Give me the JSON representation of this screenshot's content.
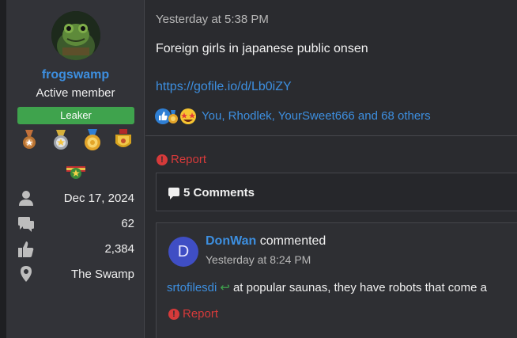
{
  "sidebar": {
    "username": "frogswamp",
    "user_title": "Active member",
    "rank_badge": "Leaker",
    "medals": [
      "bronze-medal-icon",
      "silver-medal-icon",
      "gold-medal-icon",
      "gold-shield-medal-icon",
      "red-ribbon-medal-icon"
    ],
    "stats": {
      "joined": "Dec 17, 2024",
      "messages": "62",
      "reactions": "2,384",
      "location": "The Swamp"
    }
  },
  "post": {
    "timestamp": "Yesterday at 5:38 PM",
    "text": "Foreign girls in japanese public onsen",
    "link": "https://gofile.io/d/Lb0iZY",
    "reaction_icons": [
      "like-icon",
      "award-icon",
      "star-eyes-emoji-icon"
    ],
    "reaction_users": "You, Rhodlek, YourSweet666 and 68 others",
    "report_label": "Report"
  },
  "comments": {
    "header": "5 Comments",
    "items": [
      {
        "avatar_letter": "D",
        "avatar_color": "#3f4ec4",
        "author": "DonWan",
        "verb": "commented",
        "time": "Yesterday at 8:24 PM",
        "mention": "srtofilesdi",
        "body": "at popular saunas, they have robots that come a",
        "report_label": "Report"
      }
    ]
  },
  "colors": {
    "link": "#3d8fe0",
    "rank_green": "#3fa34d",
    "report_red": "#d63a3a"
  }
}
